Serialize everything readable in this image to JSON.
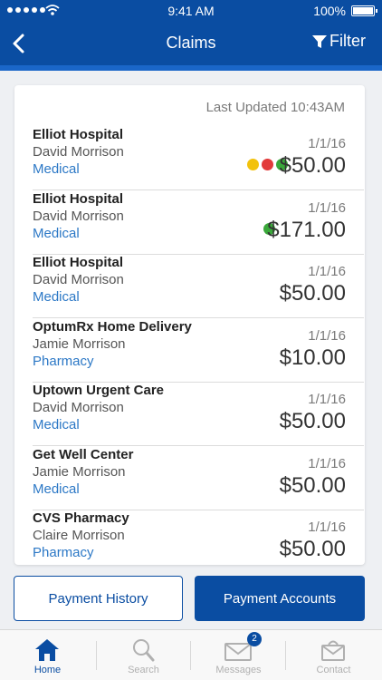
{
  "status_bar": {
    "time": "9:41 AM",
    "battery": "100%"
  },
  "nav": {
    "title": "Claims",
    "filter_label": "Filter"
  },
  "list": {
    "last_updated": "Last Updated 10:43AM",
    "claims": [
      {
        "provider": "Elliot Hospital",
        "member": "David Morrison",
        "type": "Medical",
        "date": "1/1/16",
        "amount": "$50.00",
        "status_dots": [
          "#f2c20c",
          "#e23a3a",
          "#3aa83a"
        ]
      },
      {
        "provider": "Elliot Hospital",
        "member": "David Morrison",
        "type": "Medical",
        "date": "1/1/16",
        "amount": "$171.00",
        "status_dots": [
          "#3aa83a"
        ]
      },
      {
        "provider": "Elliot Hospital",
        "member": "David Morrison",
        "type": "Medical",
        "date": "1/1/16",
        "amount": "$50.00",
        "status_dots": []
      },
      {
        "provider": "OptumRx Home Delivery",
        "member": "Jamie Morrison",
        "type": "Pharmacy",
        "date": "1/1/16",
        "amount": "$10.00",
        "status_dots": []
      },
      {
        "provider": "Uptown Urgent Care",
        "member": "David Morrison",
        "type": "Medical",
        "date": "1/1/16",
        "amount": "$50.00",
        "status_dots": []
      },
      {
        "provider": "Get Well Center",
        "member": "Jamie Morrison",
        "type": "Medical",
        "date": "1/1/16",
        "amount": "$50.00",
        "status_dots": []
      },
      {
        "provider": "CVS Pharmacy",
        "member": "Claire Morrison",
        "type": "Pharmacy",
        "date": "1/1/16",
        "amount": "$50.00",
        "status_dots": []
      }
    ]
  },
  "actions": {
    "payment_history": "Payment History",
    "payment_accounts": "Payment Accounts"
  },
  "tabs": [
    {
      "label": "Home",
      "icon": "home-icon",
      "active": true
    },
    {
      "label": "Search",
      "icon": "search-icon",
      "active": false
    },
    {
      "label": "Messages",
      "icon": "mail-icon",
      "active": false,
      "badge": "2"
    },
    {
      "label": "Contact",
      "icon": "contact-icon",
      "active": false
    }
  ],
  "colors": {
    "brand": "#0a4da2",
    "link": "#2c78c6"
  }
}
